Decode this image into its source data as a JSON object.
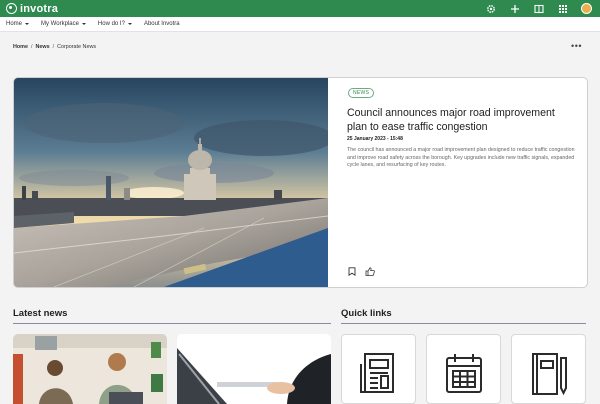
{
  "app": {
    "logo_text": "invotra"
  },
  "topbar": {
    "icons": [
      "gear-icon",
      "plus-icon",
      "book-icon",
      "grid-icon",
      "avatar"
    ]
  },
  "nav": {
    "items": [
      {
        "label": "Home",
        "has_caret": true
      },
      {
        "label": "My Workplace",
        "has_caret": true
      },
      {
        "label": "How do I?",
        "has_caret": true
      },
      {
        "label": "About Invotra",
        "has_caret": false
      }
    ]
  },
  "breadcrumb": {
    "items": [
      "Home",
      "News",
      "Corporate News"
    ],
    "separator": "/"
  },
  "featured": {
    "tag": "NEWS",
    "title": "Council announces major road improvement plan to ease traffic congestion",
    "date": "25 January 2023 - 15:48",
    "summary": "The council has announced a major road improvement plan designed to reduce traffic congestion and improve road safety across the borough. Key upgrades include new traffic signals, expanded cycle lanes, and resurfacing of key routes.",
    "image": "city-skyline-cathedral-photo"
  },
  "latest_news": {
    "title": "Latest news"
  },
  "quick_links": {
    "title": "Quick links",
    "icons": [
      "newspaper-icon",
      "calendar-icon",
      "notebook-icon"
    ]
  },
  "colors": {
    "brand": "#2e8a4f",
    "accent_rule": "#8a8aa5",
    "tag": "#2e8a4f"
  }
}
